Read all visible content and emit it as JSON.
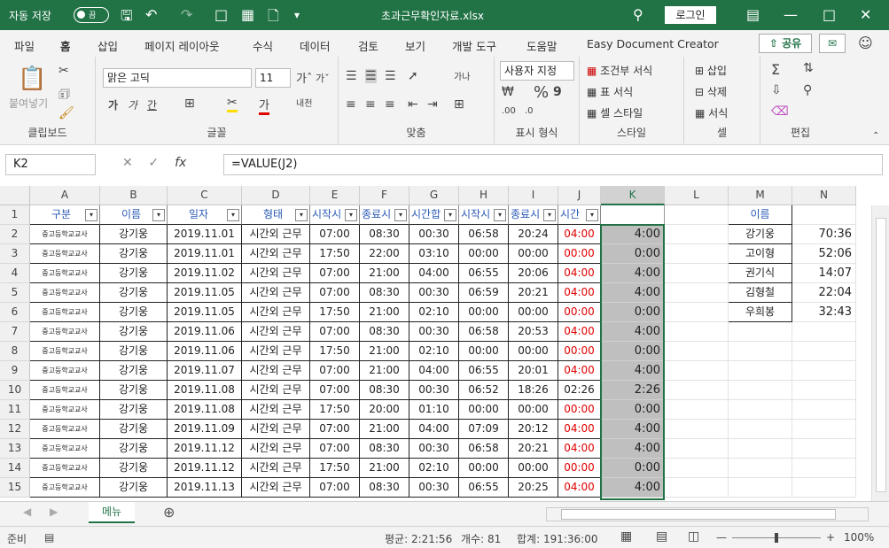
{
  "titlebar": {
    "autosave_label": "자동 저장",
    "autosave_state": "끔",
    "title": "초과근무확인자료.xlsx",
    "login": "로그인"
  },
  "menu": {
    "items": [
      "파일",
      "홈",
      "삽입",
      "페이지 레이아웃",
      "수식",
      "데이터",
      "검토",
      "보기",
      "개발 도구",
      "도움말",
      "Easy Document Creator"
    ],
    "share": "공유"
  },
  "ribbon": {
    "clipboard": {
      "paste": "붙여넣기",
      "label": "클립보드"
    },
    "font": {
      "name": "맑은 고딕",
      "size": "11",
      "label": "글꼴"
    },
    "align": {
      "label": "맞춤"
    },
    "number": {
      "format": "사용자 지정",
      "label": "표시 형식"
    },
    "style": {
      "cond": "조건부 서식",
      "table": "표 서식",
      "cell": "셀 스타일",
      "label": "스타일"
    },
    "cells": {
      "insert": "삽입",
      "delete": "삭제",
      "format": "서식",
      "label": "셀"
    },
    "edit": {
      "label": "편집"
    }
  },
  "formula_bar": {
    "name_box": "K2",
    "formula": "=VALUE(J2)"
  },
  "grid": {
    "columns": [
      "A",
      "B",
      "C",
      "D",
      "E",
      "F",
      "G",
      "H",
      "I",
      "J",
      "K",
      "L",
      "M",
      "N"
    ],
    "rows": [
      "1",
      "2",
      "3",
      "4",
      "5",
      "6",
      "7",
      "8",
      "9",
      "10",
      "11",
      "12",
      "13",
      "14",
      "15"
    ],
    "header_row": [
      "구분",
      "이름",
      "일자",
      "형태",
      "시작시",
      "종료시",
      "시간합",
      "시작시",
      "종료시",
      "시간"
    ],
    "data": [
      [
        "중고등학교교사",
        "강기웅",
        "2019.11.01",
        "시간외 근무",
        "07:00",
        "08:30",
        "00:30",
        "06:58",
        "20:24",
        "04:00",
        "4:00"
      ],
      [
        "중고등학교교사",
        "강기웅",
        "2019.11.01",
        "시간외 근무",
        "17:50",
        "22:00",
        "03:10",
        "00:00",
        "00:00",
        "00:00",
        "0:00"
      ],
      [
        "중고등학교교사",
        "강기웅",
        "2019.11.02",
        "시간외 근무",
        "07:00",
        "21:00",
        "04:00",
        "06:55",
        "20:06",
        "04:00",
        "4:00"
      ],
      [
        "중고등학교교사",
        "강기웅",
        "2019.11.05",
        "시간외 근무",
        "07:00",
        "08:30",
        "00:30",
        "06:59",
        "20:21",
        "04:00",
        "4:00"
      ],
      [
        "중고등학교교사",
        "강기웅",
        "2019.11.05",
        "시간외 근무",
        "17:50",
        "21:00",
        "02:10",
        "00:00",
        "00:00",
        "00:00",
        "0:00"
      ],
      [
        "중고등학교교사",
        "강기웅",
        "2019.11.06",
        "시간외 근무",
        "07:00",
        "08:30",
        "00:30",
        "06:58",
        "20:53",
        "04:00",
        "4:00"
      ],
      [
        "중고등학교교사",
        "강기웅",
        "2019.11.06",
        "시간외 근무",
        "17:50",
        "21:00",
        "02:10",
        "00:00",
        "00:00",
        "00:00",
        "0:00"
      ],
      [
        "중고등학교교사",
        "강기웅",
        "2019.11.07",
        "시간외 근무",
        "07:00",
        "21:00",
        "04:00",
        "06:55",
        "20:01",
        "04:00",
        "4:00"
      ],
      [
        "중고등학교교사",
        "강기웅",
        "2019.11.08",
        "시간외 근무",
        "07:00",
        "08:30",
        "00:30",
        "06:52",
        "18:26",
        "02:26",
        "2:26"
      ],
      [
        "중고등학교교사",
        "강기웅",
        "2019.11.08",
        "시간외 근무",
        "17:50",
        "20:00",
        "01:10",
        "00:00",
        "00:00",
        "00:00",
        "0:00"
      ],
      [
        "중고등학교교사",
        "강기웅",
        "2019.11.09",
        "시간외 근무",
        "07:00",
        "21:00",
        "04:00",
        "07:09",
        "20:12",
        "04:00",
        "4:00"
      ],
      [
        "중고등학교교사",
        "강기웅",
        "2019.11.12",
        "시간외 근무",
        "07:00",
        "08:30",
        "00:30",
        "06:58",
        "20:21",
        "04:00",
        "4:00"
      ],
      [
        "중고등학교교사",
        "강기웅",
        "2019.11.12",
        "시간외 근무",
        "17:50",
        "21:00",
        "02:10",
        "00:00",
        "00:00",
        "00:00",
        "0:00"
      ],
      [
        "중고등학교교사",
        "강기웅",
        "2019.11.13",
        "시간외 근무",
        "07:00",
        "08:30",
        "00:30",
        "06:55",
        "20:25",
        "04:00",
        "4:00"
      ]
    ],
    "red_j_rows": [
      0,
      1,
      2,
      3,
      4,
      5,
      6,
      7,
      9,
      10,
      11,
      12,
      13
    ],
    "summary_header": "이름",
    "summary": [
      [
        "강기웅",
        "70:36"
      ],
      [
        "고이형",
        "52:06"
      ],
      [
        "권기식",
        "14:07"
      ],
      [
        "김형철",
        "22:04"
      ],
      [
        "우희봉",
        "32:43"
      ]
    ]
  },
  "sheet_tab": "메뉴",
  "status": {
    "ready": "준비",
    "average": "평균: 2:21:56",
    "count": "개수: 81",
    "sum": "합계: 191:36:00",
    "zoom": "100%"
  },
  "colors": {
    "accent": "#217346",
    "red_text": "#e00000",
    "header_text": "#2a5ab5"
  }
}
